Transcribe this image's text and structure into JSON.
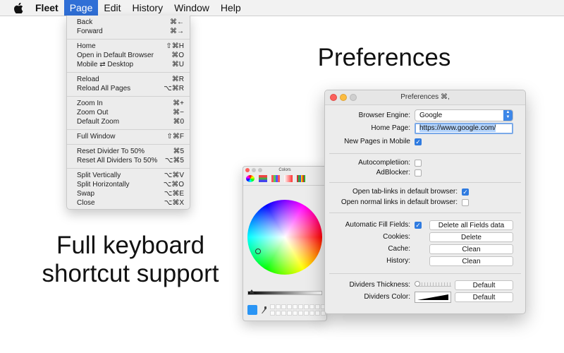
{
  "menubar": {
    "apple_icon": "apple-logo-icon",
    "app": "Fleet",
    "menus": [
      "Page",
      "Edit",
      "History",
      "Window",
      "Help"
    ]
  },
  "page_menu": {
    "items": [
      {
        "label": "Back",
        "shortcut": "⌘←"
      },
      {
        "label": "Forward",
        "shortcut": "⌘→"
      },
      {
        "label": "Home",
        "shortcut": "⇧⌘H"
      },
      {
        "label": "Open in Default Browser",
        "shortcut": "⌘O"
      },
      {
        "label": "Mobile ⇄ Desktop",
        "shortcut": "⌘U"
      },
      {
        "label": "Reload",
        "shortcut": "⌘R"
      },
      {
        "label": "Reload All Pages",
        "shortcut": "⌥⌘R"
      },
      {
        "label": "Zoom In",
        "shortcut": "⌘+"
      },
      {
        "label": "Zoom Out",
        "shortcut": "⌘−"
      },
      {
        "label": "Default Zoom",
        "shortcut": "⌘0"
      },
      {
        "label": "Full Window",
        "shortcut": "⇧⌘F"
      },
      {
        "label": "Reset Divider To 50%",
        "shortcut": "⌘5"
      },
      {
        "label": "Reset All Dividers To 50%",
        "shortcut": "⌥⌘5"
      },
      {
        "label": "Split Vertically",
        "shortcut": "⌥⌘V"
      },
      {
        "label": "Split Horizontally",
        "shortcut": "⌥⌘O"
      },
      {
        "label": "Swap",
        "shortcut": "⌥⌘E"
      },
      {
        "label": "Close",
        "shortcut": "⌥⌘X"
      }
    ]
  },
  "headline_preferences": "Preferences",
  "headline_keyboard": [
    "Full keyboard",
    "shortcut support"
  ],
  "colors_panel": {
    "title": "Colors",
    "selected_color": "#2a95f5"
  },
  "prefs": {
    "title": "Preferences ⌘,",
    "browser_engine_label": "Browser Engine:",
    "browser_engine_value": "Google",
    "home_page_label": "Home Page:",
    "home_page_value": "https://www.google.com/",
    "new_pages_mobile_label": "New Pages in Mobile",
    "new_pages_mobile_checked": true,
    "autocompletion_label": "Autocompletiion:",
    "autocompletion_checked": false,
    "adblocker_label": "AdBlocker:",
    "adblocker_checked": false,
    "open_tab_links_label": "Open tab-links in default browser:",
    "open_tab_links_checked": true,
    "open_normal_links_label": "Open normal links in default browser:",
    "open_normal_links_checked": false,
    "auto_fill_label": "Automatic Fill Fields:",
    "auto_fill_checked": true,
    "delete_fields_button": "Delete all Fields data",
    "cookies_label": "Cookies:",
    "cookies_button": "Delete",
    "cache_label": "Cache:",
    "cache_button": "Clean",
    "history_label": "History:",
    "history_button": "Clean",
    "dividers_thickness_label": "Dividers Thickness:",
    "dividers_thickness_button": "Default",
    "dividers_color_label": "Dividers Color:",
    "dividers_color_button": "Default",
    "dividers_color_swatch": "#000000"
  }
}
